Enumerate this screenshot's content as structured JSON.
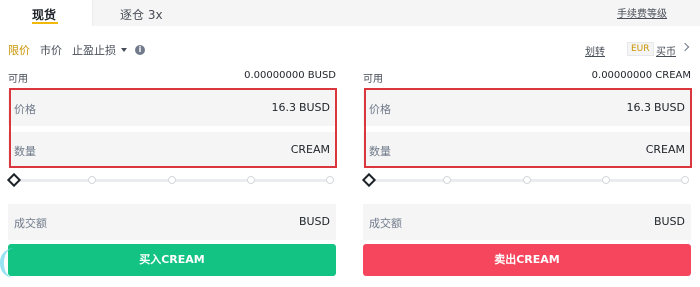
{
  "tabs": {
    "spot": "现货",
    "margin": "逐仓 3x",
    "fee_link": "手续费等级"
  },
  "order_types": {
    "limit": "限价",
    "market": "市价",
    "stop": "止盈止损",
    "info_icon": "i"
  },
  "header_right": {
    "transfer": "划转",
    "currency_badge": "EUR",
    "buy_coin": "买币"
  },
  "buy": {
    "available_label": "可用",
    "available_value": "0.00000000 BUSD",
    "price_label": "价格",
    "price_value": "16.3",
    "price_unit": "BUSD",
    "qty_label": "数量",
    "qty_unit": "CREAM",
    "total_label": "成交额",
    "total_unit": "BUSD",
    "button": "买入CREAM"
  },
  "sell": {
    "available_label": "可用",
    "available_value": "0.00000000 CREAM",
    "price_label": "价格",
    "price_value": "16.3",
    "price_unit": "BUSD",
    "qty_label": "数量",
    "qty_unit": "CREAM",
    "total_label": "成交额",
    "total_unit": "BUSD",
    "button": "卖出CREAM"
  },
  "colors": {
    "accent": "#f0b90b",
    "buy": "#13c383",
    "sell": "#f6465d",
    "highlight": "#d9363e"
  },
  "slider_percent": 0
}
